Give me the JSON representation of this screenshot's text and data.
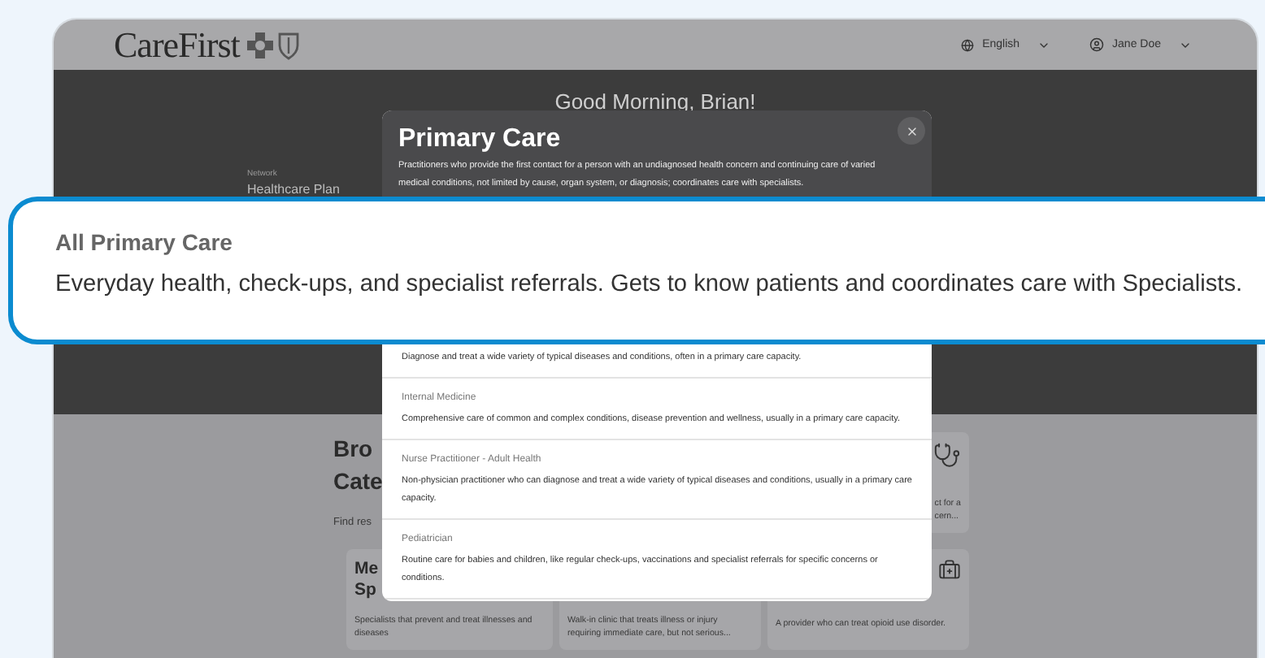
{
  "header": {
    "logo": "CareFirst",
    "language": "English",
    "user": "Jane Doe"
  },
  "hero": {
    "greeting": "Good Morning, Brian!",
    "network_label": "Network",
    "network_value": "Healthcare Plan"
  },
  "browse": {
    "heading_lines": [
      "Bro",
      "Cate"
    ],
    "subtitle": "Find res",
    "cards": [
      {
        "kind": "stethoscope",
        "lines": [
          "ct for a",
          "cern..."
        ]
      },
      {
        "kind": "plain",
        "title_lines": [
          "Me",
          "Sp"
        ],
        "lines": [
          "Specialists that prevent and treat illnesses and",
          "diseases"
        ]
      },
      {
        "kind": "plain",
        "lines": [
          "Walk-in clinic that treats illness or injury",
          "requiring immediate care, but not serious..."
        ]
      },
      {
        "kind": "medical-kit",
        "lines": [
          "A provider who can treat opioid use disorder."
        ]
      }
    ]
  },
  "modal": {
    "title": "Primary Care",
    "description": "Practitioners who provide the first contact for a person with an undiagnosed health concern and continuing care of varied medical conditions, not limited by cause, organ system, or diagnosis; coordinates care with specialists.",
    "items": [
      {
        "description": "Diagnose and treat a wide variety of typical diseases and conditions, often in a primary care capacity."
      },
      {
        "name": "Internal Medicine",
        "description": "Comprehensive care of common and complex conditions, disease prevention and wellness, usually in a primary care capacity."
      },
      {
        "name": "Nurse Practitioner - Adult Health",
        "description": "Non-physician practitioner who can diagnose and treat a wide variety of typical diseases and conditions, usually in a primary care capacity."
      },
      {
        "name": "Pediatrician",
        "description": "Routine care for babies and children, like regular check-ups, vaccinations and specialist referrals for specific concerns or conditions."
      }
    ]
  },
  "callout": {
    "title": "All Primary Care",
    "description": "Everyday health, check-ups, and specialist referrals. Gets to know patients and coordinates care with Specialists."
  }
}
